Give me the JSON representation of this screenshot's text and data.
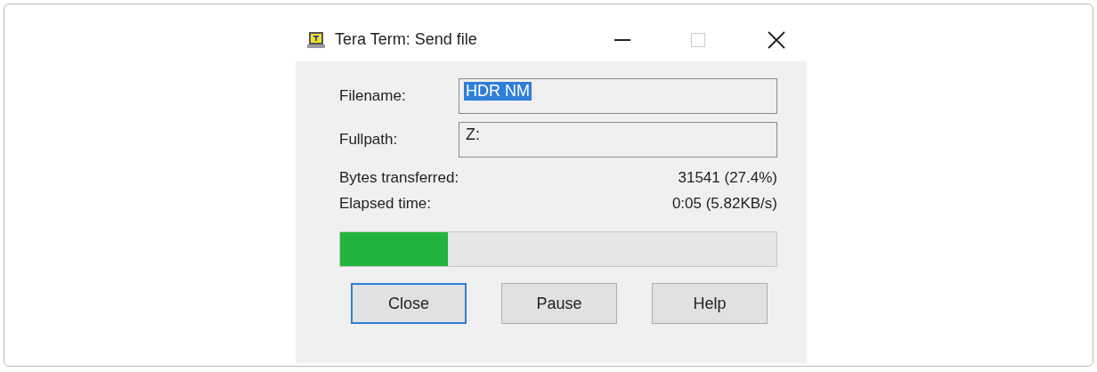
{
  "window": {
    "title": "Tera Term: Send file"
  },
  "fields": [
    {
      "label": "Filename:",
      "value": "HDR NM",
      "value_selected": true
    },
    {
      "label": "Fullpath:",
      "value": "Z:",
      "value_selected": false
    }
  ],
  "stats": [
    {
      "label": "Bytes transferred:",
      "value": "31541 (27.4%)"
    },
    {
      "label": "Elapsed time:",
      "value": "0:05 (5.82KB/s)"
    }
  ],
  "progress": {
    "level": 0.246
  },
  "buttons": [
    {
      "label": "Close",
      "focused": true
    },
    {
      "label": "Pause",
      "focused": false
    },
    {
      "label": "Help",
      "focused": false
    }
  ]
}
